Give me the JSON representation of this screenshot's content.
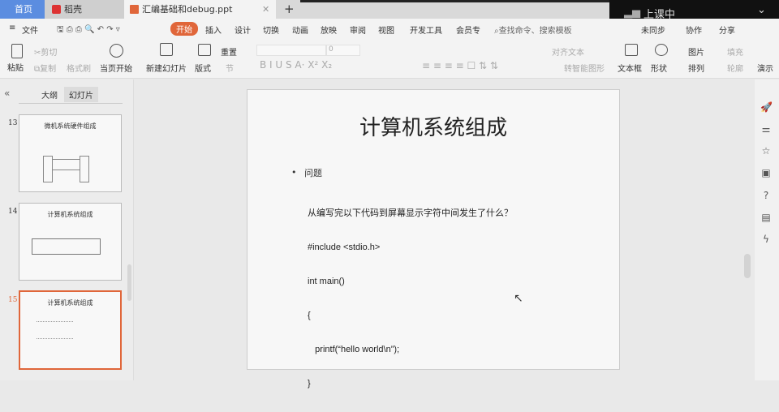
{
  "tabs": {
    "home": "首页",
    "daoke": "稻壳",
    "doc": "汇编基础和debug.ppt",
    "add": "+"
  },
  "overlay": {
    "status": "上课中"
  },
  "menu": {
    "file": "文件",
    "items": [
      "开始",
      "插入",
      "设计",
      "切换",
      "动画",
      "放映",
      "审阅",
      "视图",
      "开发工具",
      "会员专"
    ],
    "search_placeholder": "查找命令、搜索模板",
    "sync": "未同步",
    "collab": "协作",
    "share": "分享"
  },
  "ribbon": {
    "paste": "粘贴",
    "cut": "剪切",
    "copy": "复制",
    "format_painter": "格式刷",
    "play_current": "当页开始",
    "new_slide": "新建幻灯片",
    "layout": "版式",
    "reset": "重置",
    "section": "节",
    "font_size": "0",
    "align_text": "对齐文本",
    "smartart": "转智能图形",
    "textbox": "文本框",
    "shape": "形状",
    "picture": "图片",
    "arrange": "排列",
    "fill": "填充",
    "outline": "轮廓",
    "present": "演示"
  },
  "panel": {
    "outline_tab": "大纲",
    "slides_tab": "幻灯片",
    "active_tab": "幻灯片",
    "thumbs": [
      {
        "num": "13",
        "title": "微机系统硬件组成"
      },
      {
        "num": "14",
        "title": "计算机系统组成"
      },
      {
        "num": "15",
        "title": "计算机系统组成"
      }
    ],
    "selected": "15"
  },
  "slide": {
    "title": "计算机系统组成",
    "bullet": "问题",
    "lines": [
      "从编写完以下代码到屏幕显示字符中间发生了什么？",
      "#include <stdio.h>",
      "int main()",
      "{",
      "   printf(“hello world\\n”);",
      "}"
    ]
  },
  "colors": {
    "accent": "#e0663a",
    "home_tab": "#5b8de0"
  }
}
